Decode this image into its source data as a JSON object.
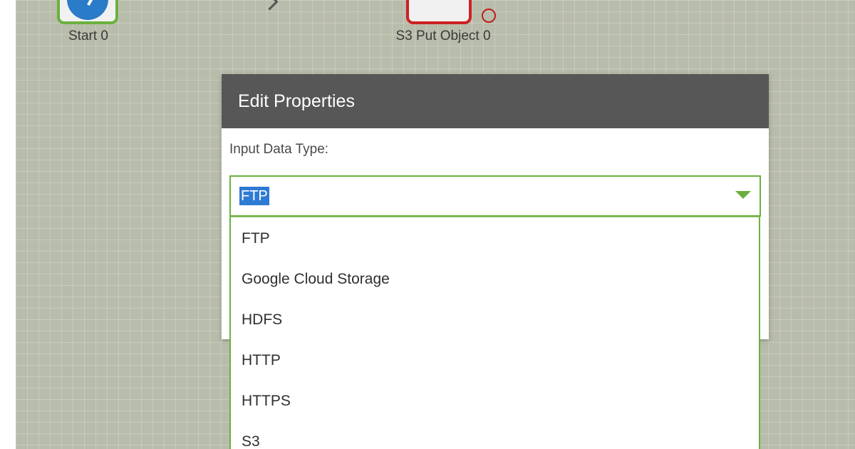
{
  "canvas": {
    "nodes": [
      {
        "label": "Start 0",
        "icon": "play-circle-icon"
      },
      {
        "label": "S3 Put Object 0",
        "icon": "s3-put-object-icon"
      }
    ]
  },
  "dialog": {
    "title": "Edit Properties",
    "field_label": "Input Data Type:",
    "select_value": "FTP",
    "options": [
      "FTP",
      "Google Cloud Storage",
      "HDFS",
      "HTTP",
      "HTTPS",
      "S3"
    ]
  },
  "colors": {
    "accent": "#6bb03e",
    "header": "#565756",
    "selection": "#2e7ad4",
    "error": "#cc2222",
    "node_icon": "#2a7bc8"
  }
}
